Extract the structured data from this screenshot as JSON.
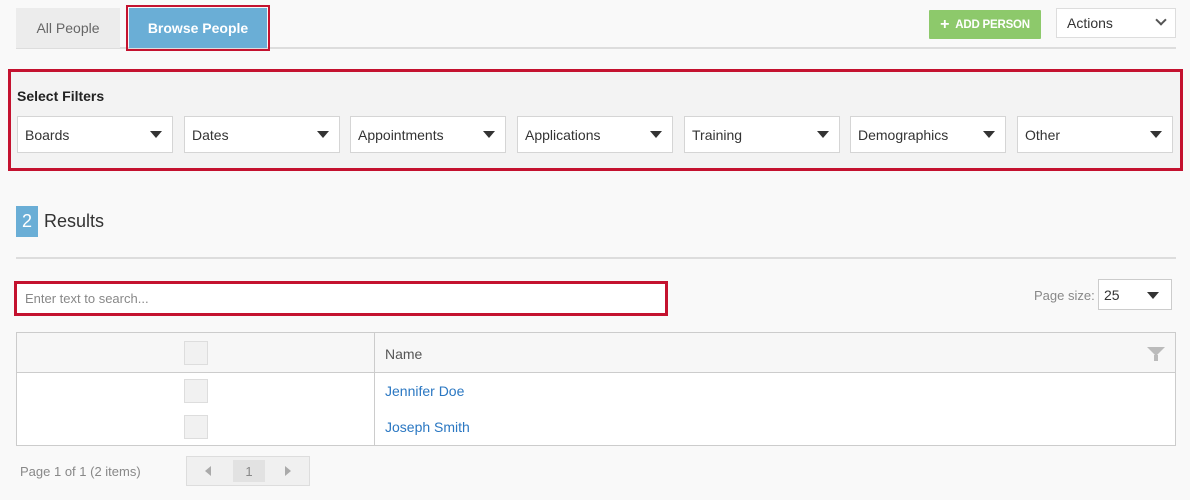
{
  "tabs": [
    {
      "label": "All People",
      "active": false
    },
    {
      "label": "Browse People",
      "active": true
    }
  ],
  "toolbar": {
    "add_person_label": "ADD PERSON",
    "actions_label": "Actions"
  },
  "filters": {
    "title": "Select Filters",
    "items": [
      "Boards",
      "Dates",
      "Appointments",
      "Applications",
      "Training",
      "Demographics",
      "Other"
    ]
  },
  "results": {
    "count": "2",
    "label": "Results"
  },
  "search": {
    "placeholder": "Enter text to search..."
  },
  "page_size": {
    "label": "Page size:",
    "value": "25"
  },
  "table": {
    "columns": [
      "Name"
    ],
    "rows": [
      {
        "name": "Jennifer Doe"
      },
      {
        "name": "Joseph Smith"
      }
    ]
  },
  "pager": {
    "info": "Page 1 of 1 (2 items)",
    "current_page": "1"
  },
  "colors": {
    "accent_blue": "#6aaed6",
    "add_green": "#8dc96b",
    "highlight_red": "#c4122f",
    "link_blue": "#2a77c2"
  }
}
